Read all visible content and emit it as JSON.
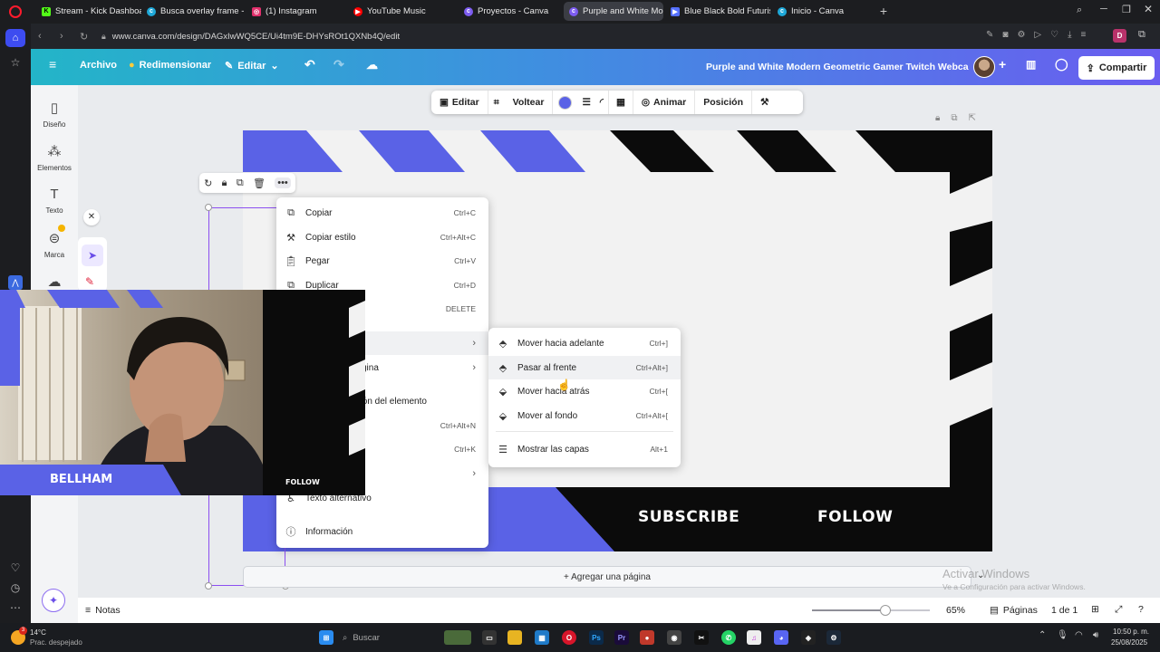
{
  "browser": {
    "tabs": [
      {
        "title": "Stream - Kick Dashboard",
        "color": "#53fc18"
      },
      {
        "title": "Busca overlay frame - Can",
        "color": "#1ea8d8"
      },
      {
        "title": "(1) Instagram",
        "color": "#e1306c"
      },
      {
        "title": "YouTube Music",
        "color": "#ff0000"
      },
      {
        "title": "Proyectos - Canva",
        "color": "#7d5cf0"
      },
      {
        "title": "Purple and White Modern",
        "color": "#7d5cf0"
      },
      {
        "title": "Blue Black Bold Futuristic",
        "color": "#5570ff"
      },
      {
        "title": "Inicio - Canva",
        "color": "#1ea8d8"
      }
    ],
    "url": "www.canva.com/design/DAGxIwWQ5CE/Ui4tm9E-DHYsROt1QXNb4Q/edit",
    "profile_letter": "D"
  },
  "canva_header": {
    "file": "Archivo",
    "resize": "Redimensionar",
    "edit": "Editar",
    "doc_title": "Purple and White Modern Geometric Gamer Twitch Webca...",
    "share": "Compartir"
  },
  "sidebar": {
    "items": [
      {
        "label": "Diseño",
        "icon": "layout-icon"
      },
      {
        "label": "Elementos",
        "icon": "elements-icon"
      },
      {
        "label": "Texto",
        "icon": "text-icon"
      },
      {
        "label": "Marca",
        "icon": "brand-icon"
      }
    ]
  },
  "toolbar": {
    "edit": "Editar",
    "flip": "Voltear",
    "animate": "Animar",
    "position": "Posición",
    "fill_color": "#5a62e6"
  },
  "context_menu": {
    "items": [
      {
        "label": "Copiar",
        "shortcut": "Ctrl+C"
      },
      {
        "label": "Copiar estilo",
        "shortcut": "Ctrl+Alt+C"
      },
      {
        "label": "Pegar",
        "shortcut": "Ctrl+V"
      },
      {
        "label": "Duplicar",
        "shortcut": "Ctrl+D"
      },
      {
        "label": "",
        "shortcut": "DELETE"
      },
      {
        "label": "",
        "shortcut": ""
      },
      {
        "label": "gina",
        "shortcut": ""
      },
      {
        "label": "ación del elemento",
        "shortcut": ""
      },
      {
        "label": "",
        "shortcut": "Ctrl+Alt+N"
      },
      {
        "label": "",
        "shortcut": "Ctrl+K"
      },
      {
        "label": "",
        "shortcut": ""
      },
      {
        "label": "Texto alternativo",
        "shortcut": ""
      },
      {
        "label": "Información",
        "shortcut": ""
      }
    ]
  },
  "submenu": {
    "items": [
      {
        "label": "Mover hacia adelante",
        "shortcut": "Ctrl+]"
      },
      {
        "label": "Pasar al frente",
        "shortcut": "Ctrl+Alt+]"
      },
      {
        "label": "Mover hacia atrás",
        "shortcut": "Ctrl+["
      },
      {
        "label": "Mover al fondo",
        "shortcut": "Ctrl+Alt+["
      },
      {
        "label": "Mostrar las capas",
        "shortcut": "Alt+1"
      }
    ]
  },
  "design": {
    "subscribe": "SUBSCRIBE",
    "follow": "FOLLOW",
    "accent": "#5a62e6"
  },
  "webcam": {
    "name": "BELLHAM",
    "follow": "FOLLOW"
  },
  "add_page": "+ Agregar una página",
  "watermark": {
    "title": "Activar Windows",
    "subtitle": "Ve a Configuración para activar Windows."
  },
  "bottom_bar": {
    "notes": "Notas",
    "zoom": "65%",
    "pages": "Páginas",
    "page_count": "1 de 1",
    "zoom_fraction": 0.62
  },
  "taskbar": {
    "temp": "14°C",
    "weather": "Prac. despejado",
    "search": "Buscar",
    "time": "10:50 p. m.",
    "date": "25/08/2025",
    "notification_count": "3"
  }
}
